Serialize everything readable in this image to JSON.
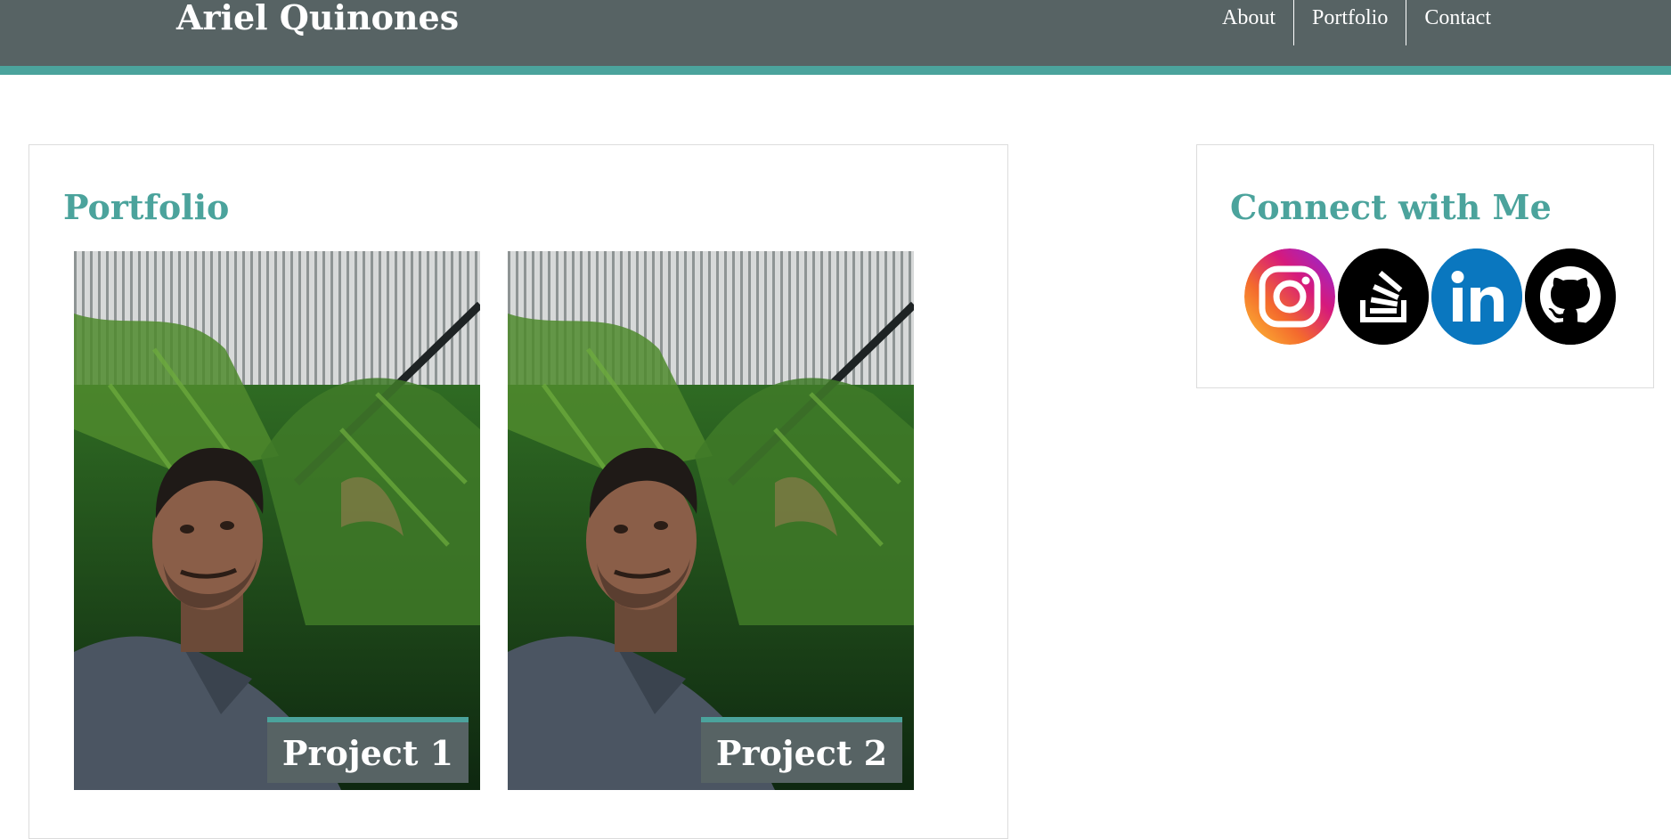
{
  "header": {
    "site_title": "Ariel Quinones",
    "nav": [
      "About",
      "Portfolio",
      "Contact"
    ]
  },
  "portfolio": {
    "title": "Portfolio",
    "projects": [
      {
        "label": "Project 1"
      },
      {
        "label": "Project 2"
      }
    ]
  },
  "connect": {
    "title": "Connect with Me",
    "icons": [
      "instagram-icon",
      "stack-overflow-icon",
      "linkedin-icon",
      "github-icon"
    ]
  },
  "colors": {
    "header_bg": "#576364",
    "accent": "#4ba39c",
    "linkedin_blue": "#0a77bf"
  }
}
